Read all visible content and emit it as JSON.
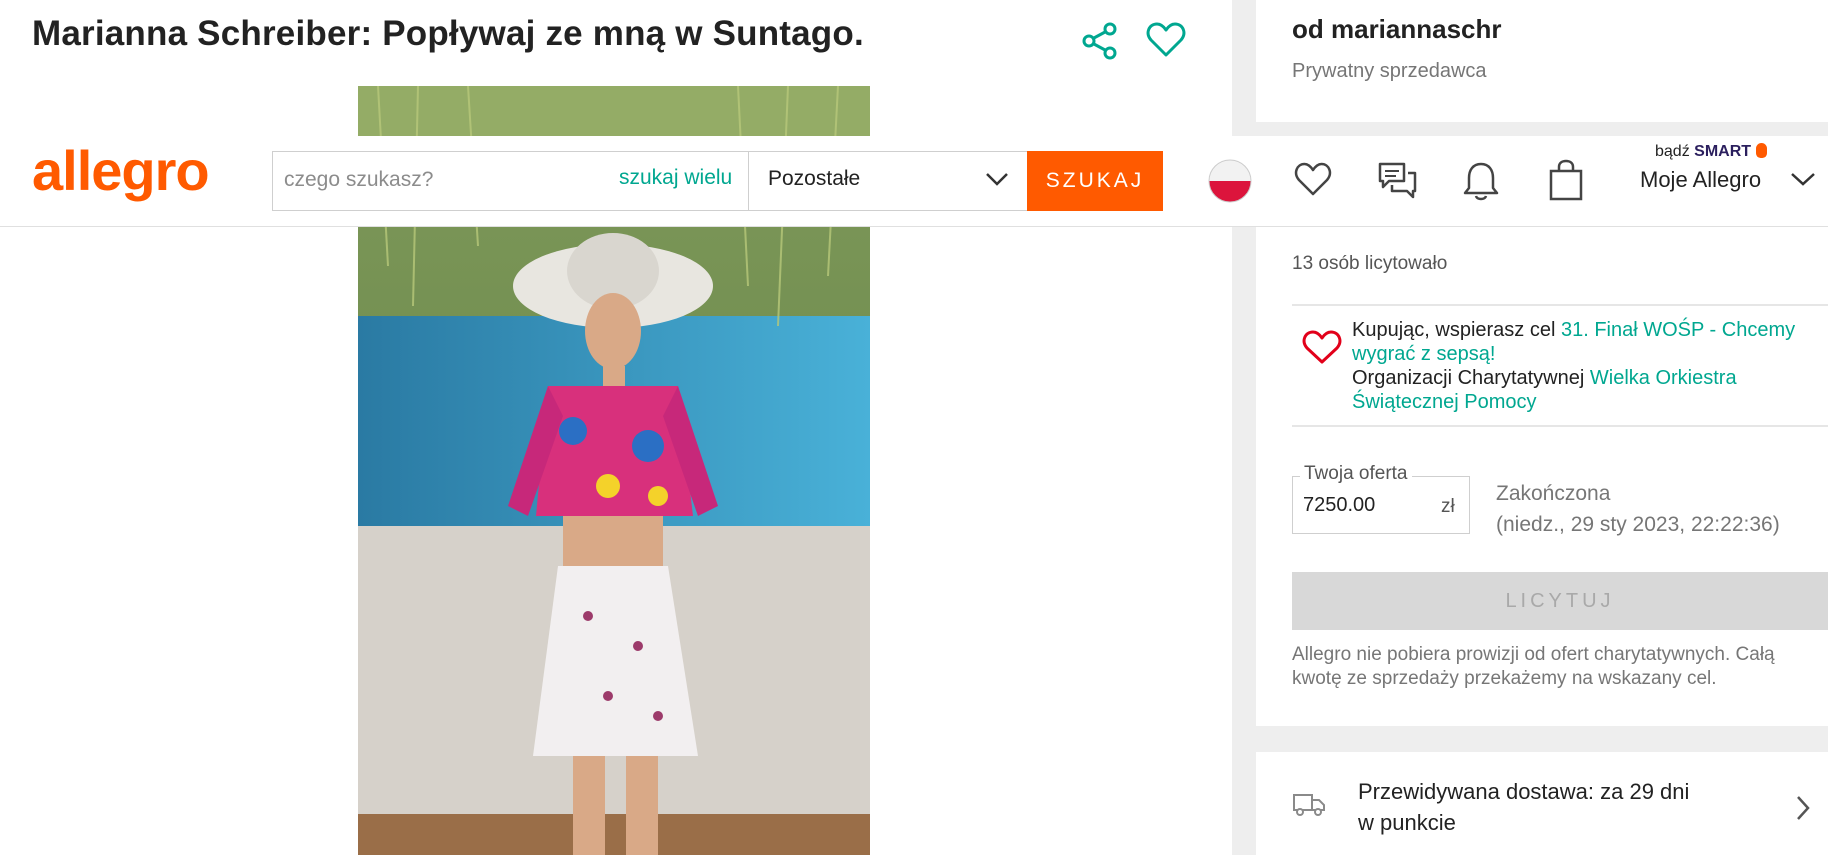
{
  "listing": {
    "title": "Marianna Schreiber: Popływaj ze mną w Suntago."
  },
  "header": {
    "logo": "allegro",
    "search_placeholder": "czego szukasz?",
    "search_many": "szukaj wielu",
    "category": "Pozostałe",
    "search_button": "SZUKAJ",
    "smart_prefix": "bądź",
    "smart_label": "SMART",
    "account": "Moje Allegro"
  },
  "seller": {
    "name": "od mariannaschr",
    "type": "Prywatny sprzedawca"
  },
  "auction": {
    "bidders": "13 osób licytowało",
    "charity_prefix": "Kupując, wspierasz cel ",
    "charity_goal": "31. Finał WOŚP - Chcemy wygrać z sepsą!",
    "org_prefix": "Organizacji Charytatywnej ",
    "org_name": "Wielka Orkiestra Świątecznej Pomocy",
    "bid_label": "Twoja oferta",
    "bid_value": "7250.00",
    "currency": "zł",
    "status": "Zakończona",
    "end_date": "(niedz., 29 sty 2023, 22:22:36)",
    "bid_button": "LICYTUJ",
    "commission_note": "Allegro nie pobiera prowizji od ofert charytatywnych. Całą kwotę ze sprzedaży przekażemy na wskazany cel."
  },
  "delivery": {
    "line1": "Przewidywana dostawa: za 29 dni",
    "line2": "w punkcie"
  },
  "icons": [
    "share-icon",
    "favorite-icon",
    "poland-flag-icon",
    "heart-icon",
    "messages-icon",
    "bell-icon",
    "cart-bag-icon",
    "chevron-down-icon",
    "charity-heart-icon",
    "truck-icon",
    "chevron-right-icon"
  ],
  "colors": {
    "brand": "#ff5a00",
    "link": "#00a790",
    "charity": "#e2001a",
    "smart": "#2b1f5e"
  }
}
